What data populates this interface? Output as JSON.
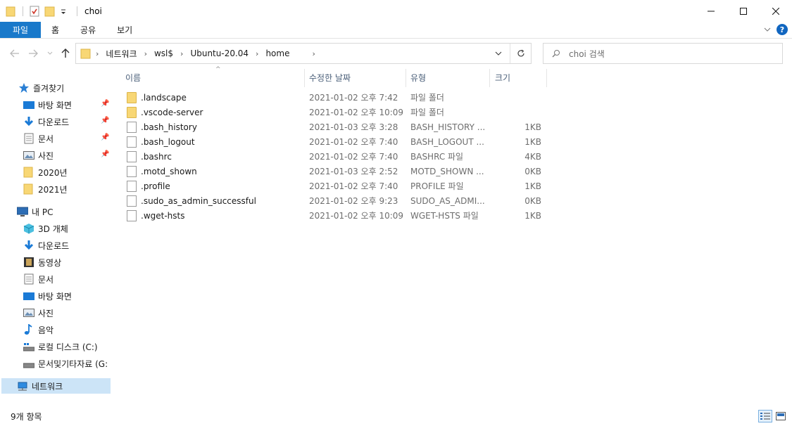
{
  "window": {
    "title": "choi"
  },
  "ribbon": {
    "tabs": [
      "파일",
      "홈",
      "공유",
      "보기"
    ]
  },
  "address": {
    "crumbs": [
      "네트워크",
      "wsl$",
      "Ubuntu-20.04",
      "home"
    ]
  },
  "search": {
    "placeholder": "choi 검색"
  },
  "sidebar": {
    "quick_access": "즐겨찾기",
    "quick_items": [
      "바탕 화면",
      "다운로드",
      "문서",
      "사진",
      "2020년",
      "2021년"
    ],
    "this_pc": "내 PC",
    "pc_items": [
      "3D 개체",
      "다운로드",
      "동영상",
      "문서",
      "바탕 화면",
      "사진",
      "음악",
      "로컬 디스크 (C:)",
      "문서및기타자료 (G:"
    ],
    "network": "네트워크"
  },
  "columns": {
    "name": "이름",
    "date": "수정한 날짜",
    "type": "유형",
    "size": "크기"
  },
  "files": [
    {
      "name": ".landscape",
      "date": "2021-01-02 오후 7:42",
      "type": "파일 폴더",
      "size": "",
      "kind": "folder"
    },
    {
      "name": ".vscode-server",
      "date": "2021-01-02 오후 10:09",
      "type": "파일 폴더",
      "size": "",
      "kind": "folder"
    },
    {
      "name": ".bash_history",
      "date": "2021-01-03 오후 3:28",
      "type": "BASH_HISTORY ...",
      "size": "1KB",
      "kind": "file"
    },
    {
      "name": ".bash_logout",
      "date": "2021-01-02 오후 7:40",
      "type": "BASH_LOGOUT ...",
      "size": "1KB",
      "kind": "file"
    },
    {
      "name": ".bashrc",
      "date": "2021-01-02 오후 7:40",
      "type": "BASHRC 파일",
      "size": "4KB",
      "kind": "file"
    },
    {
      "name": ".motd_shown",
      "date": "2021-01-03 오후 2:52",
      "type": "MOTD_SHOWN ...",
      "size": "0KB",
      "kind": "file"
    },
    {
      "name": ".profile",
      "date": "2021-01-02 오후 7:40",
      "type": "PROFILE 파일",
      "size": "1KB",
      "kind": "file"
    },
    {
      "name": ".sudo_as_admin_successful",
      "date": "2021-01-02 오후 9:23",
      "type": "SUDO_AS_ADMI...",
      "size": "0KB",
      "kind": "file"
    },
    {
      "name": ".wget-hsts",
      "date": "2021-01-02 오후 10:09",
      "type": "WGET-HSTS 파일",
      "size": "1KB",
      "kind": "file"
    }
  ],
  "status": {
    "count": "9개 항목"
  },
  "colors": {
    "accent": "#1979ca",
    "folder": "#f8d775",
    "selected": "#cce4f7"
  }
}
